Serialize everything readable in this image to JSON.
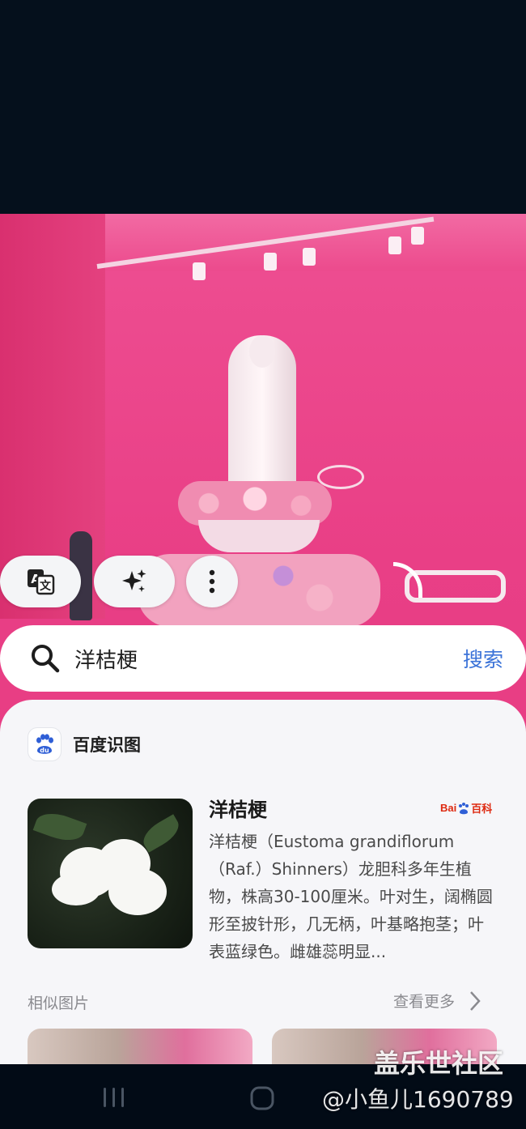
{
  "search": {
    "query": "洋桔梗",
    "button_label": "搜索"
  },
  "source": {
    "name": "百度识图"
  },
  "result": {
    "title": "洋桔梗",
    "brand_bai": "Bai",
    "brand_baike": "百科",
    "description": "洋桔梗（Eustoma grandiflorum（Raf.）Shinners）龙胆科多年生植物，株高30-100厘米。叶对生，阔椭圆形至披针形，几无柄，叶基略抱茎；叶表蓝绿色。雌雄蕊明显..."
  },
  "similar": {
    "label": "相似图片",
    "more_label": "查看更多"
  },
  "watermark": {
    "line1": "盖乐世社区",
    "line2": "@小鱼儿1690789"
  },
  "colors": {
    "accent": "#3b73d8",
    "brand_red": "#de2910",
    "photo_pink": "#e93f86"
  }
}
